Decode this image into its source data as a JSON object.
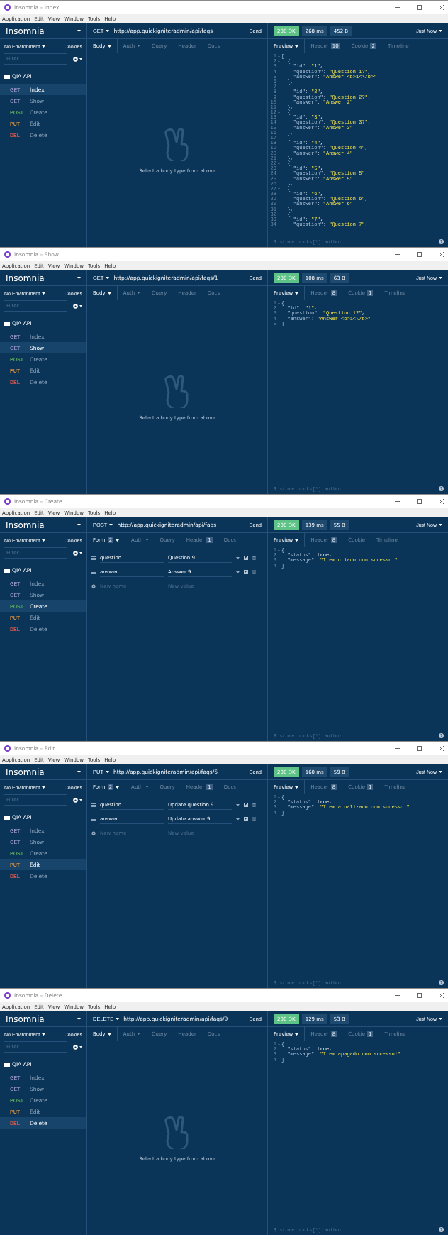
{
  "windows": [
    {
      "title": "Insomnia – Index",
      "menu": [
        "Application",
        "Edit",
        "View",
        "Window",
        "Tools",
        "Help"
      ],
      "sidebar": {
        "brand": "Insomnia",
        "environment": "No Environment",
        "cookies": "Cookies",
        "filter_placeholder": "Filter",
        "folder": "QIA API",
        "items": [
          {
            "method": "GET",
            "color": "#8a8fc0",
            "label": "Index",
            "selected": true
          },
          {
            "method": "GET",
            "color": "#8a8fc0",
            "label": "Show",
            "selected": false
          },
          {
            "method": "POST",
            "color": "#59a85a",
            "label": "Create",
            "selected": false
          },
          {
            "method": "PUT",
            "color": "#d38b3a",
            "label": "Edit",
            "selected": false
          },
          {
            "method": "DEL",
            "color": "#d0574f",
            "label": "Delete",
            "selected": false
          }
        ]
      },
      "request": {
        "method": "GET",
        "url": "http://app.quickigniteradmin/api/faqs",
        "send": "Send",
        "tabs": [
          {
            "label": "Body",
            "dropdown": true,
            "selected": true
          },
          {
            "label": "Auth",
            "dropdown": true,
            "selected": false
          },
          {
            "label": "Query",
            "dropdown": false,
            "selected": false
          },
          {
            "label": "Header",
            "dropdown": false,
            "selected": false
          },
          {
            "label": "Docs",
            "dropdown": false,
            "selected": false
          }
        ],
        "body": {
          "kind": "empty",
          "message": "Select a body type from above"
        }
      },
      "response": {
        "status": "200 OK",
        "time": "268 ms",
        "size": "452 B",
        "timestamp": "Just Now",
        "tabs": [
          {
            "label": "Preview",
            "dropdown": true,
            "selected": true
          },
          {
            "label": "Header",
            "count": "10",
            "dropdown": false,
            "selected": false
          },
          {
            "label": "Cookie",
            "count": "2",
            "dropdown": false,
            "selected": false
          },
          {
            "label": "Timeline",
            "dropdown": false,
            "selected": false
          }
        ],
        "lines": [
          {
            "n": "1",
            "fold": true,
            "text": "["
          },
          {
            "n": "2",
            "fold": true,
            "text": "  {"
          },
          {
            "n": "3",
            "fold": false,
            "text": "    \"id\": ",
            "value": "\"1\"",
            "after": ","
          },
          {
            "n": "4",
            "fold": false,
            "text": "    \"question\": ",
            "value": "\"Question 1?\"",
            "after": ","
          },
          {
            "n": "5",
            "fold": false,
            "text": "    \"answer\": ",
            "value": "\"Answer <b>1<\\/b>\""
          },
          {
            "n": "6",
            "fold": false,
            "text": "  },"
          },
          {
            "n": "7",
            "fold": true,
            "text": "  {"
          },
          {
            "n": "8",
            "fold": false,
            "text": "    \"id\": ",
            "value": "\"2\"",
            "after": ","
          },
          {
            "n": "9",
            "fold": false,
            "text": "    \"question\": ",
            "value": "\"Question 2?\"",
            "after": ","
          },
          {
            "n": "10",
            "fold": false,
            "text": "    \"answer\": ",
            "value": "\"Answer 2\""
          },
          {
            "n": "11",
            "fold": false,
            "text": "  },"
          },
          {
            "n": "12",
            "fold": true,
            "text": "  {"
          },
          {
            "n": "13",
            "fold": false,
            "text": "    \"id\": ",
            "value": "\"3\"",
            "after": ","
          },
          {
            "n": "14",
            "fold": false,
            "text": "    \"question\": ",
            "value": "\"Question 3?\"",
            "after": ","
          },
          {
            "n": "15",
            "fold": false,
            "text": "    \"answer\": ",
            "value": "\"Answer 3\""
          },
          {
            "n": "16",
            "fold": false,
            "text": "  },"
          },
          {
            "n": "17",
            "fold": true,
            "text": "  {"
          },
          {
            "n": "18",
            "fold": false,
            "text": "    \"id\": ",
            "value": "\"4\"",
            "after": ","
          },
          {
            "n": "19",
            "fold": false,
            "text": "    \"question\": ",
            "value": "\"Question 4\"",
            "after": ","
          },
          {
            "n": "20",
            "fold": false,
            "text": "    \"answer\": ",
            "value": "\"Answer 4\""
          },
          {
            "n": "21",
            "fold": false,
            "text": "  },"
          },
          {
            "n": "22",
            "fold": true,
            "text": "  {"
          },
          {
            "n": "23",
            "fold": false,
            "text": "    \"id\": ",
            "value": "\"5\"",
            "after": ","
          },
          {
            "n": "24",
            "fold": false,
            "text": "    \"question\": ",
            "value": "\"Question 5\"",
            "after": ","
          },
          {
            "n": "25",
            "fold": false,
            "text": "    \"answer\": ",
            "value": "\"Answer 5\""
          },
          {
            "n": "26",
            "fold": false,
            "text": "  },"
          },
          {
            "n": "27",
            "fold": true,
            "text": "  {"
          },
          {
            "n": "28",
            "fold": false,
            "text": "    \"id\": ",
            "value": "\"6\"",
            "after": ","
          },
          {
            "n": "29",
            "fold": false,
            "text": "    \"question\": ",
            "value": "\"Question 6\"",
            "after": ","
          },
          {
            "n": "30",
            "fold": false,
            "text": "    \"answer\": ",
            "value": "\"Answer 6\""
          },
          {
            "n": "31",
            "fold": false,
            "text": "  },"
          },
          {
            "n": "32",
            "fold": true,
            "text": "  {"
          },
          {
            "n": "33",
            "fold": false,
            "text": "    \"id\": ",
            "value": "\"7\"",
            "after": ","
          },
          {
            "n": "34",
            "fold": false,
            "text": "    \"question\": ",
            "value": "\"Question 7\"",
            "after": ","
          }
        ],
        "filter_placeholder": "$.store.books[*].author"
      }
    },
    {
      "title": "Insomnia – Show",
      "menu": [
        "Application",
        "Edit",
        "View",
        "Window",
        "Tools",
        "Help"
      ],
      "sidebar": {
        "brand": "Insomnia",
        "environment": "No Environment",
        "cookies": "Cookies",
        "filter_placeholder": "Filter",
        "folder": "QIA API",
        "items": [
          {
            "method": "GET",
            "color": "#8a8fc0",
            "label": "Index",
            "selected": false
          },
          {
            "method": "GET",
            "color": "#8a8fc0",
            "label": "Show",
            "selected": true
          },
          {
            "method": "POST",
            "color": "#59a85a",
            "label": "Create",
            "selected": false
          },
          {
            "method": "PUT",
            "color": "#d38b3a",
            "label": "Edit",
            "selected": false
          },
          {
            "method": "DEL",
            "color": "#d0574f",
            "label": "Delete",
            "selected": false
          }
        ]
      },
      "request": {
        "method": "GET",
        "url": "http://app.quickigniteradmin/api/faqs/1",
        "send": "Send",
        "tabs": [
          {
            "label": "Body",
            "dropdown": true,
            "selected": true
          },
          {
            "label": "Auth",
            "dropdown": true,
            "selected": false
          },
          {
            "label": "Query",
            "dropdown": false,
            "selected": false
          },
          {
            "label": "Header",
            "dropdown": false,
            "selected": false
          },
          {
            "label": "Docs",
            "dropdown": false,
            "selected": false
          }
        ],
        "body": {
          "kind": "empty",
          "message": "Select a body type from above"
        }
      },
      "response": {
        "status": "200 OK",
        "time": "108 ms",
        "size": "63 B",
        "timestamp": "Just Now",
        "tabs": [
          {
            "label": "Preview",
            "dropdown": true,
            "selected": true
          },
          {
            "label": "Header",
            "count": "8",
            "dropdown": false,
            "selected": false
          },
          {
            "label": "Cookie",
            "count": "1",
            "dropdown": false,
            "selected": false
          },
          {
            "label": "Timeline",
            "dropdown": false,
            "selected": false
          }
        ],
        "lines": [
          {
            "n": "1",
            "fold": true,
            "text": "{"
          },
          {
            "n": "2",
            "fold": false,
            "text": "  \"id\": ",
            "value": "\"1\"",
            "after": ","
          },
          {
            "n": "3",
            "fold": false,
            "text": "  \"question\": ",
            "value": "\"Question 1?\"",
            "after": ","
          },
          {
            "n": "4",
            "fold": false,
            "text": "  \"answer\": ",
            "value": "\"Answer <b>1<\\/b>\""
          },
          {
            "n": "5",
            "fold": false,
            "text": "}"
          }
        ],
        "filter_placeholder": "$.store.books[*].author"
      }
    },
    {
      "title": "Insomnia – Create",
      "menu": [
        "Application",
        "Edit",
        "View",
        "Window",
        "Tools",
        "Help"
      ],
      "sidebar": {
        "brand": "Insomnia",
        "environment": "No Environment",
        "cookies": "Cookies",
        "filter_placeholder": "Filter",
        "folder": "QIA API",
        "items": [
          {
            "method": "GET",
            "color": "#8a8fc0",
            "label": "Index",
            "selected": false
          },
          {
            "method": "GET",
            "color": "#8a8fc0",
            "label": "Show",
            "selected": false
          },
          {
            "method": "POST",
            "color": "#59a85a",
            "label": "Create",
            "selected": true
          },
          {
            "method": "PUT",
            "color": "#d38b3a",
            "label": "Edit",
            "selected": false
          },
          {
            "method": "DEL",
            "color": "#d0574f",
            "label": "Delete",
            "selected": false
          }
        ]
      },
      "request": {
        "method": "POST",
        "url": "http://app.quickigniteradmin/api/faqs",
        "send": "Send",
        "tabs": [
          {
            "label": "Form",
            "count": "2",
            "dropdown": true,
            "selected": true
          },
          {
            "label": "Auth",
            "dropdown": true,
            "selected": false
          },
          {
            "label": "Query",
            "dropdown": false,
            "selected": false
          },
          {
            "label": "Header",
            "count": "1",
            "dropdown": false,
            "selected": false
          },
          {
            "label": "Docs",
            "dropdown": false,
            "selected": false
          }
        ],
        "body": {
          "kind": "form",
          "rows": [
            {
              "name": "question",
              "value": "Question 9",
              "enabled": true
            },
            {
              "name": "answer",
              "value": "Answer 9",
              "enabled": true
            }
          ],
          "new_name_placeholder": "New name",
          "new_value_placeholder": "New value"
        }
      },
      "response": {
        "status": "200 OK",
        "time": "139 ms",
        "size": "55 B",
        "timestamp": "Just Now",
        "tabs": [
          {
            "label": "Preview",
            "dropdown": true,
            "selected": true
          },
          {
            "label": "Header",
            "count": "8",
            "dropdown": false,
            "selected": false
          },
          {
            "label": "Cookie",
            "dropdown": false,
            "selected": false
          },
          {
            "label": "Timeline",
            "dropdown": false,
            "selected": false
          }
        ],
        "lines": [
          {
            "n": "1",
            "fold": true,
            "text": "{"
          },
          {
            "n": "2",
            "fold": false,
            "text": "  \"status\": ",
            "literal": "true",
            "after": ","
          },
          {
            "n": "3",
            "fold": false,
            "text": "  \"message\": ",
            "value": "\"Item criado com sucesso!\""
          },
          {
            "n": "4",
            "fold": false,
            "text": "}"
          }
        ],
        "filter_placeholder": "$.store.books[*].author"
      }
    },
    {
      "title": "Insomnia – Edit",
      "menu": [
        "Application",
        "Edit",
        "View",
        "Window",
        "Tools",
        "Help"
      ],
      "sidebar": {
        "brand": "Insomnia",
        "environment": "No Environment",
        "cookies": "Cookies",
        "filter_placeholder": "Filter",
        "folder": "QIA API",
        "items": [
          {
            "method": "GET",
            "color": "#8a8fc0",
            "label": "Index",
            "selected": false
          },
          {
            "method": "GET",
            "color": "#8a8fc0",
            "label": "Show",
            "selected": false
          },
          {
            "method": "POST",
            "color": "#59a85a",
            "label": "Create",
            "selected": false
          },
          {
            "method": "PUT",
            "color": "#d38b3a",
            "label": "Edit",
            "selected": true
          },
          {
            "method": "DEL",
            "color": "#d0574f",
            "label": "Delete",
            "selected": false
          }
        ]
      },
      "request": {
        "method": "PUT",
        "url": "http://app.quickigniteradmin/api/faqs/6",
        "send": "Send",
        "tabs": [
          {
            "label": "Form",
            "count": "2",
            "dropdown": true,
            "selected": true
          },
          {
            "label": "Auth",
            "dropdown": true,
            "selected": false
          },
          {
            "label": "Query",
            "dropdown": false,
            "selected": false
          },
          {
            "label": "Header",
            "count": "1",
            "dropdown": false,
            "selected": false
          },
          {
            "label": "Docs",
            "dropdown": false,
            "selected": false
          }
        ],
        "body": {
          "kind": "form",
          "rows": [
            {
              "name": "question",
              "value": "Update question 9",
              "enabled": true
            },
            {
              "name": "answer",
              "value": "Update answer 9",
              "enabled": true
            }
          ],
          "new_name_placeholder": "New name",
          "new_value_placeholder": "New value"
        }
      },
      "response": {
        "status": "200 OK",
        "time": "160 ms",
        "size": "59 B",
        "timestamp": "Just Now",
        "tabs": [
          {
            "label": "Preview",
            "dropdown": true,
            "selected": true
          },
          {
            "label": "Header",
            "count": "8",
            "dropdown": false,
            "selected": false
          },
          {
            "label": "Cookie",
            "count": "1",
            "dropdown": false,
            "selected": false
          },
          {
            "label": "Timeline",
            "dropdown": false,
            "selected": false
          }
        ],
        "lines": [
          {
            "n": "1",
            "fold": true,
            "text": "{"
          },
          {
            "n": "2",
            "fold": false,
            "text": "  \"status\": ",
            "literal": "true",
            "after": ","
          },
          {
            "n": "3",
            "fold": false,
            "text": "  \"message\": ",
            "value": "\"Item atualizado com sucesso!\""
          },
          {
            "n": "4",
            "fold": false,
            "text": "}"
          }
        ],
        "filter_placeholder": "$.store.books[*].author"
      }
    },
    {
      "title": "Insomnia – Delete",
      "menu": [
        "Application",
        "Edit",
        "View",
        "Window",
        "Tools",
        "Help"
      ],
      "sidebar": {
        "brand": "Insomnia",
        "environment": "No Environment",
        "cookies": "Cookies",
        "filter_placeholder": "Filter",
        "folder": "QIA API",
        "items": [
          {
            "method": "GET",
            "color": "#8a8fc0",
            "label": "Index",
            "selected": false
          },
          {
            "method": "GET",
            "color": "#8a8fc0",
            "label": "Show",
            "selected": false
          },
          {
            "method": "POST",
            "color": "#59a85a",
            "label": "Create",
            "selected": false
          },
          {
            "method": "PUT",
            "color": "#d38b3a",
            "label": "Edit",
            "selected": false
          },
          {
            "method": "DEL",
            "color": "#d0574f",
            "label": "Delete",
            "selected": true
          }
        ]
      },
      "request": {
        "method": "DELETE",
        "url": "http://app.quickigniteradmin/api/faqs/9",
        "send": "Send",
        "tabs": [
          {
            "label": "Body",
            "dropdown": true,
            "selected": true
          },
          {
            "label": "Auth",
            "dropdown": true,
            "selected": false
          },
          {
            "label": "Query",
            "dropdown": false,
            "selected": false
          },
          {
            "label": "Header",
            "dropdown": false,
            "selected": false
          },
          {
            "label": "Docs",
            "dropdown": false,
            "selected": false
          }
        ],
        "body": {
          "kind": "empty",
          "message": "Select a body type from above"
        }
      },
      "response": {
        "status": "200 OK",
        "time": "129 ms",
        "size": "53 B",
        "timestamp": "Just Now",
        "tabs": [
          {
            "label": "Preview",
            "dropdown": true,
            "selected": true
          },
          {
            "label": "Header",
            "count": "8",
            "dropdown": false,
            "selected": false
          },
          {
            "label": "Cookie",
            "count": "1",
            "dropdown": false,
            "selected": false
          },
          {
            "label": "Timeline",
            "dropdown": false,
            "selected": false
          }
        ],
        "lines": [
          {
            "n": "1",
            "fold": true,
            "text": "{"
          },
          {
            "n": "2",
            "fold": false,
            "text": "  \"status\": ",
            "literal": "true",
            "after": ","
          },
          {
            "n": "3",
            "fold": false,
            "text": "  \"message\": ",
            "value": "\"Item apagado com sucesso!\""
          },
          {
            "n": "4",
            "fold": false,
            "text": "}"
          }
        ],
        "filter_placeholder": "$.store.books[*].author"
      }
    }
  ]
}
